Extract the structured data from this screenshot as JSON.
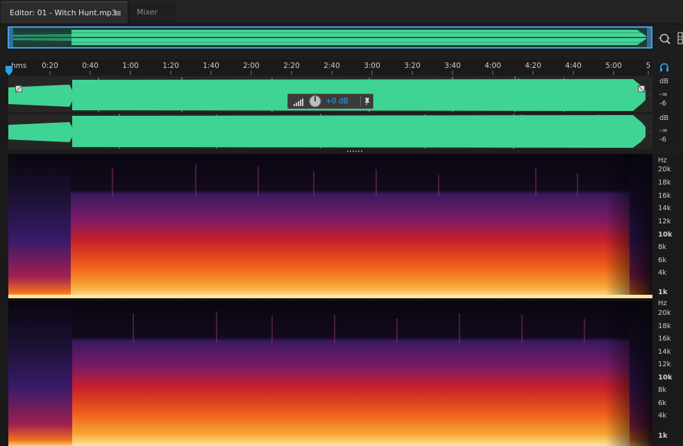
{
  "tabs": {
    "editor_label": "Editor: 01 - Witch Hunt.mp3",
    "menu_icon": "≡",
    "mixer_label": "Mixer"
  },
  "ruler": {
    "unit": "hms",
    "ticks": [
      "0:20",
      "0:40",
      "1:00",
      "1:20",
      "1:40",
      "2:00",
      "2:20",
      "2:40",
      "3:00",
      "3:20",
      "3:40",
      "4:00",
      "4:20",
      "4:40",
      "5:00",
      "5"
    ]
  },
  "hud": {
    "gain": "+0 dB"
  },
  "wave_scale": {
    "top": [
      "dB",
      "-∞",
      "-6"
    ],
    "bottom": [
      "dB",
      "-∞",
      "-6"
    ]
  },
  "spec_scale": {
    "unit": "Hz",
    "labels": [
      "20k",
      "18k",
      "16k",
      "14k",
      "12k",
      "10k",
      "8k",
      "6k",
      "4k",
      "1k"
    ]
  },
  "colors": {
    "waveform": "#3fd494",
    "selection_border": "#4aa0e0",
    "accent": "#2ea0e8"
  },
  "icons": [
    "menu-icon",
    "zoom-icon",
    "panel-edge-icon",
    "playhead-icon",
    "headphones-icon",
    "volume-icon",
    "gain-knob-icon",
    "pin-icon",
    "fade-in-handle-icon",
    "fade-out-handle-icon"
  ]
}
